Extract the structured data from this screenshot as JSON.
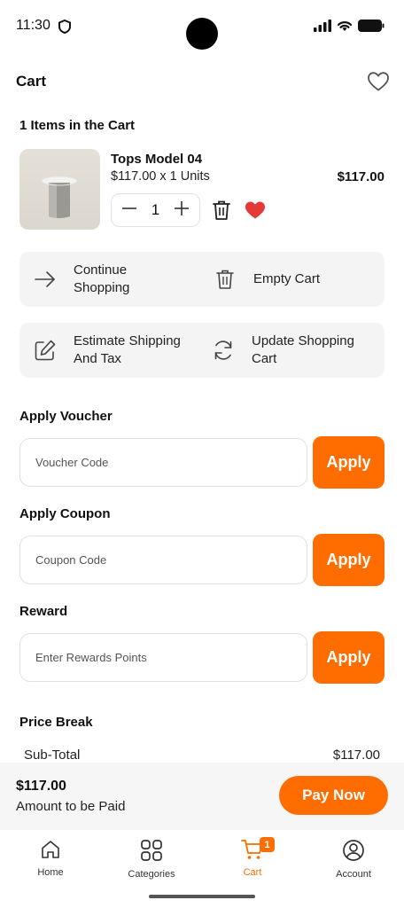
{
  "status": {
    "time": "11:30"
  },
  "header": {
    "title": "Cart"
  },
  "cart": {
    "count_label": "1 Items in the Cart",
    "item": {
      "name": "Tops Model 04",
      "unit_line": "$117.00 x 1 Units",
      "total": "$117.00",
      "quantity": "1",
      "favorited": true
    }
  },
  "actions": {
    "continue_label": "Continue Shopping",
    "empty_label": "Empty Cart",
    "estimate_label": "Estimate Shipping And Tax",
    "update_label": "Update Shopping Cart"
  },
  "voucher": {
    "title": "Apply Voucher",
    "placeholder": "Voucher Code",
    "button": "Apply"
  },
  "coupon": {
    "title": "Apply Coupon",
    "placeholder": "Coupon Code",
    "button": "Apply"
  },
  "reward": {
    "title": "Reward",
    "placeholder": "Enter Rewards Points",
    "button": "Apply"
  },
  "price_break": {
    "title": "Price Break",
    "subtotal_label": "Sub-Total",
    "subtotal_value": "$117.00"
  },
  "pay": {
    "amount": "$117.00",
    "caption": "Amount to be Paid",
    "button": "Pay Now"
  },
  "nav": {
    "home": "Home",
    "categories": "Categories",
    "cart": "Cart",
    "cart_badge": "1",
    "account": "Account",
    "active": "cart"
  },
  "colors": {
    "accent": "#ff6d00",
    "heart": "#e53935",
    "card_bg": "#f4f4f4"
  }
}
